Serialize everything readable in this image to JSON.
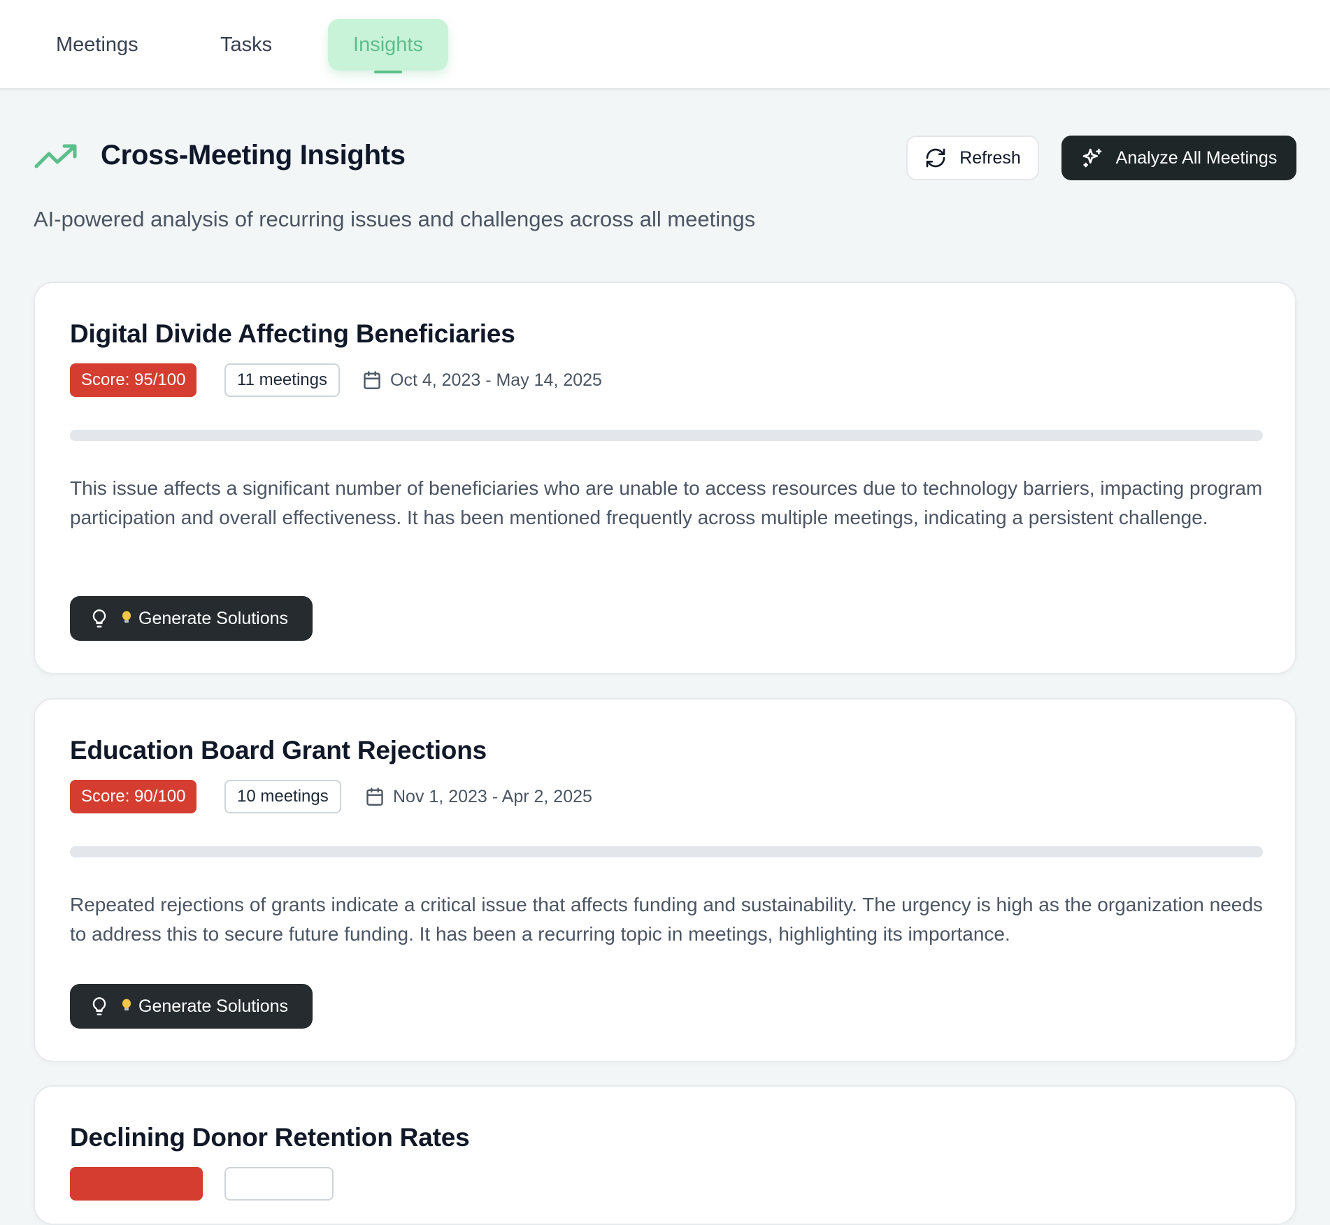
{
  "nav": {
    "tabs": [
      {
        "label": "Meetings"
      },
      {
        "label": "Tasks"
      },
      {
        "label": "Insights",
        "active": true
      }
    ]
  },
  "header": {
    "title": "Cross-Meeting Insights",
    "subtitle": "AI-powered analysis of recurring issues and challenges across all meetings",
    "refresh_label": "Refresh",
    "analyze_label": "Analyze All Meetings"
  },
  "insights": [
    {
      "title": "Digital Divide Affecting Beneficiaries",
      "score_label": "Score: 95/100",
      "score": 95,
      "meetings_label": "11 meetings",
      "date_range": "Oct 4, 2023 - May 14, 2025",
      "description": "This issue affects a significant number of beneficiaries who are unable to access resources due to technology barriers, impacting program participation and overall effectiveness. It has been mentioned frequently across multiple meetings, indicating a persistent challenge.",
      "button_label": "Generate Solutions"
    },
    {
      "title": "Education Board Grant Rejections",
      "score_label": "Score: 90/100",
      "score": 90,
      "meetings_label": "10 meetings",
      "date_range": "Nov 1, 2023 - Apr 2, 2025",
      "description": "Repeated rejections of grants indicate a critical issue that affects funding and sustainability. The urgency is high as the organization needs to address this to secure future funding. It has been a recurring topic in meetings, highlighting its importance.",
      "button_label": "Generate Solutions"
    },
    {
      "title": "Declining Donor Retention Rates"
    }
  ],
  "colors": {
    "accent": "#5bbf8a",
    "score_badge": "#d43d2f",
    "dark_button": "#1e2628"
  },
  "icons": {
    "trend": "trending-up-icon",
    "refresh": "refresh-icon",
    "analyze": "sparkles-icon",
    "date": "calendar-icon",
    "solutions": "lightbulb-icon"
  }
}
